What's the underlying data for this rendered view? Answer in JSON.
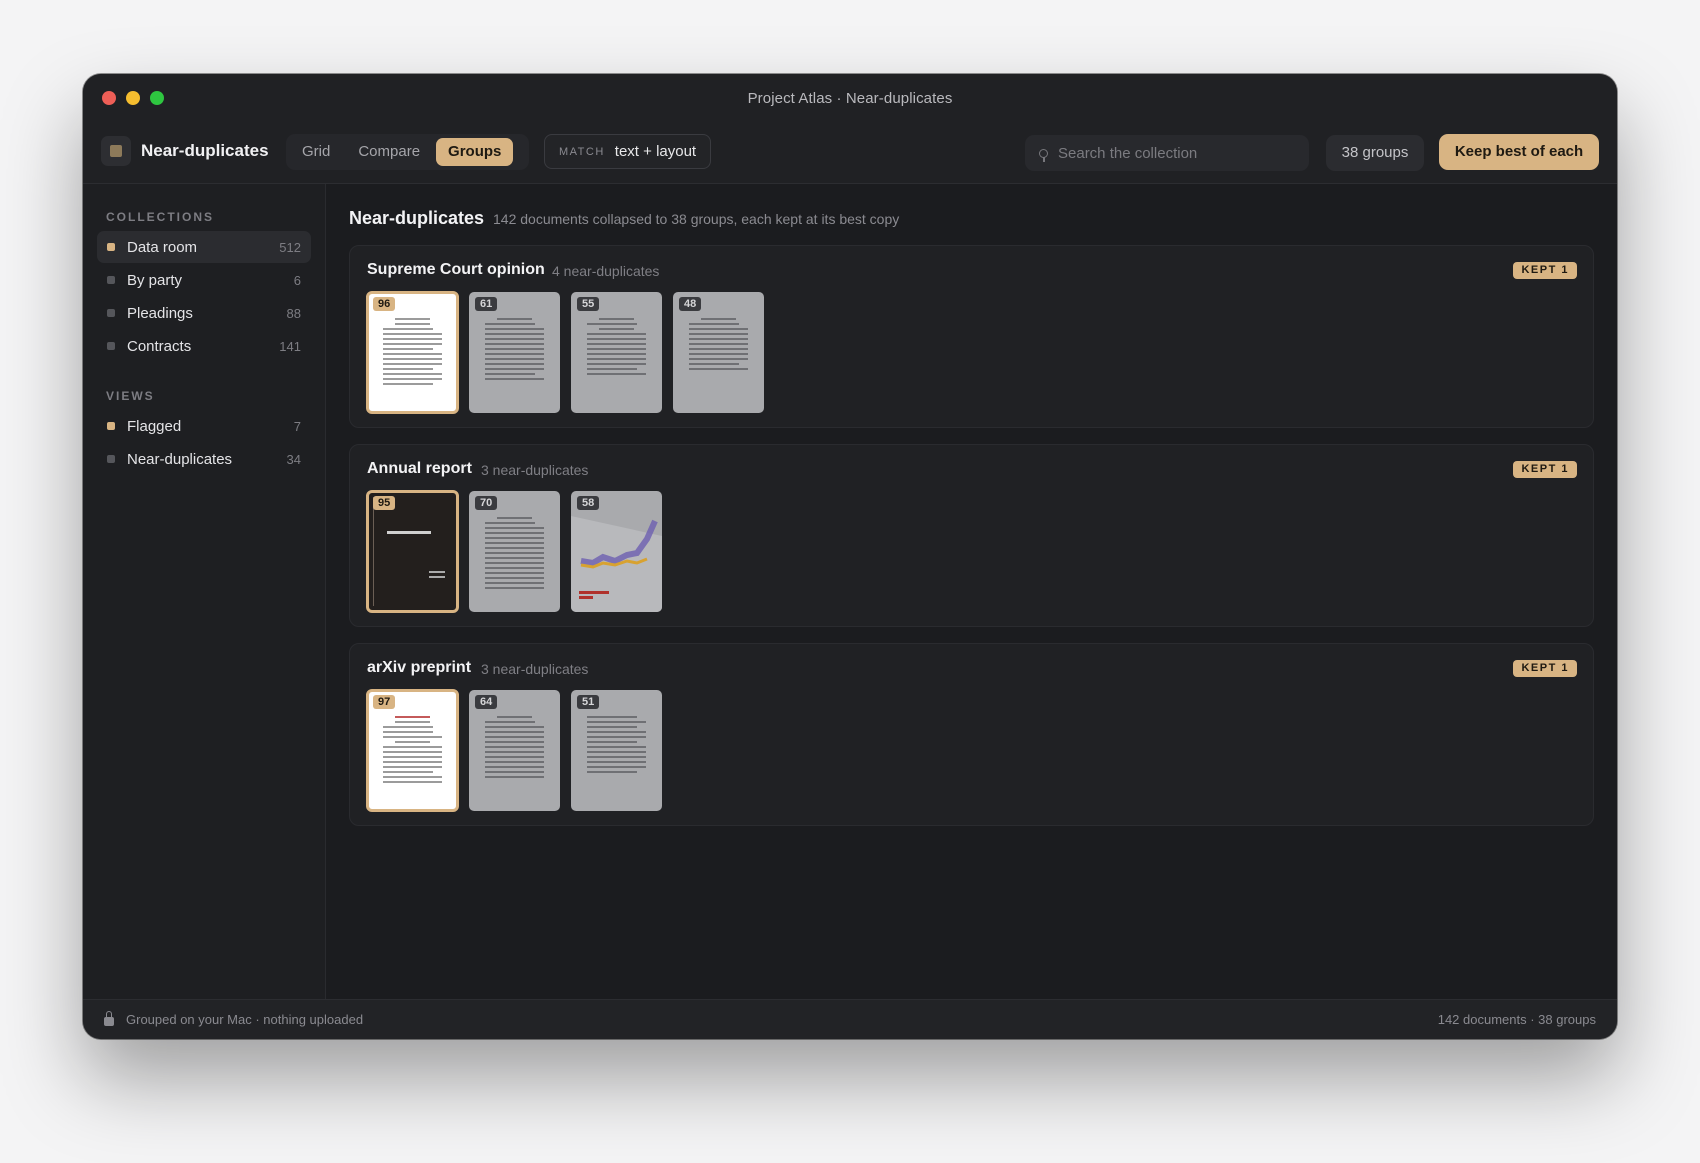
{
  "window": {
    "title": "Project Atlas · Near-duplicates"
  },
  "toolbar": {
    "app_name": "Near-duplicates",
    "views": [
      "Grid",
      "Compare",
      "Groups"
    ],
    "active_view": "Groups",
    "match_label": "MATCH",
    "match_value": "text + layout",
    "search_placeholder": "Search the collection",
    "groups_count": "38 groups",
    "keep_button": "Keep best of each"
  },
  "sidebar": {
    "collections_heading": "COLLECTIONS",
    "collections": [
      {
        "label": "Data room",
        "count": "512",
        "active": true
      },
      {
        "label": "By party",
        "count": "6"
      },
      {
        "label": "Pleadings",
        "count": "88"
      },
      {
        "label": "Contracts",
        "count": "141"
      }
    ],
    "views_heading": "VIEWS",
    "views": [
      {
        "label": "Flagged",
        "count": "7"
      },
      {
        "label": "Near-duplicates",
        "count": "34"
      }
    ]
  },
  "main": {
    "title": "Near-duplicates",
    "subtitle": "142 documents collapsed to 38 groups, each kept at its best copy",
    "groups": [
      {
        "title": "Supreme Court opinion",
        "count_label": "4 near-duplicates",
        "badge": "KEPT 1",
        "scores": [
          "96",
          "61",
          "55",
          "48"
        ]
      },
      {
        "title": "Annual report",
        "count_label": "3 near-duplicates",
        "badge": "KEPT 1",
        "scores": [
          "95",
          "70",
          "58"
        ]
      },
      {
        "title": "arXiv preprint",
        "count_label": "3 near-duplicates",
        "badge": "KEPT 1",
        "scores": [
          "97",
          "64",
          "51"
        ]
      }
    ]
  },
  "status": {
    "left": "Grouped on your Mac · nothing uploaded",
    "right": "142 documents · 38 groups"
  }
}
